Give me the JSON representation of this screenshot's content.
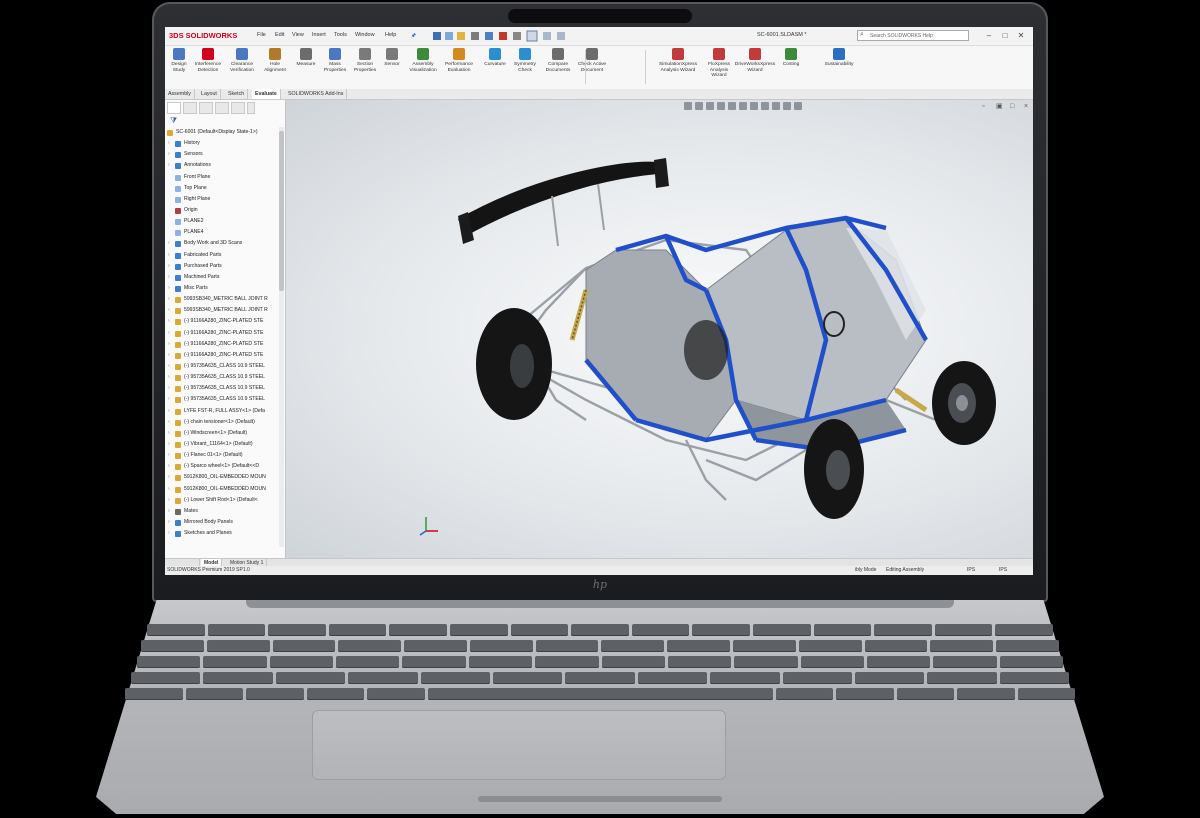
{
  "app": {
    "logo": "3DS SOLIDWORKS",
    "menus": [
      "File",
      "Edit",
      "View",
      "Insert",
      "Tools",
      "Window",
      "Help"
    ],
    "document_title": "SC-6001.SLDASM *",
    "help_search_placeholder": "Search SOLIDWORKS Help"
  },
  "ribbon": {
    "buttons": [
      {
        "label": "Design Study",
        "icon": "design-study-icon",
        "color": "#4a78c2"
      },
      {
        "label": "Interference Detection",
        "icon": "interference-icon",
        "color": "#d0021b"
      },
      {
        "label": "Clearance Verification",
        "icon": "clearance-icon",
        "color": "#4a78c2"
      },
      {
        "label": "Hole Alignment",
        "icon": "hole-alignment-icon",
        "color": "#b07a2a"
      },
      {
        "label": "Measure",
        "icon": "measure-icon",
        "color": "#6c6c6c"
      },
      {
        "label": "Mass Properties",
        "icon": "mass-properties-icon",
        "color": "#4a78c2"
      },
      {
        "label": "Section Properties",
        "icon": "section-properties-icon",
        "color": "#7a7a7a"
      },
      {
        "label": "Sensor",
        "icon": "sensor-icon",
        "color": "#7a7a7a"
      },
      {
        "label": "Assembly Visualization",
        "icon": "assembly-visualization-icon",
        "color": "#3b8b3b"
      },
      {
        "label": "Performance Evaluation",
        "icon": "performance-icon",
        "color": "#d28a1e"
      },
      {
        "label": "Curvature",
        "icon": "curvature-icon",
        "color": "#2a8fd0"
      },
      {
        "label": "Symmetry Check",
        "icon": "symmetry-icon",
        "color": "#2a8fd0"
      },
      {
        "label": "Compare Documents",
        "icon": "compare-icon",
        "color": "#6c6c6c"
      },
      {
        "label": "Check Active Document",
        "icon": "check-active-icon",
        "color": "#6c6c6c"
      },
      {
        "label": "SimulationXpress Analysis Wizard",
        "icon": "simulationxpress-icon",
        "color": "#c23b3b"
      },
      {
        "label": "FloXpress Analysis Wizard",
        "icon": "floxpress-icon",
        "color": "#c23b3b"
      },
      {
        "label": "DriveWorksXpress Wizard",
        "icon": "driveworks-icon",
        "color": "#c23b3b"
      },
      {
        "label": "Costing",
        "icon": "costing-icon",
        "color": "#3b8b3b"
      },
      {
        "label": "Sustainability",
        "icon": "sustainability-icon",
        "color": "#2a6fc2"
      }
    ]
  },
  "command_tabs": [
    "Assembly",
    "Layout",
    "Sketch",
    "Evaluate",
    "SOLIDWORKS Add-Ins"
  ],
  "active_command_tab": "Evaluate",
  "feature_tree": {
    "root": "SC-6001  (Default<Display State-1>)",
    "items": [
      {
        "label": "History",
        "icon": "folder"
      },
      {
        "label": "Sensors",
        "icon": "folder"
      },
      {
        "label": "Annotations",
        "icon": "folder"
      },
      {
        "label": "Front Plane",
        "icon": "plane"
      },
      {
        "label": "Top Plane",
        "icon": "plane"
      },
      {
        "label": "Right Plane",
        "icon": "plane"
      },
      {
        "label": "Origin",
        "icon": "origin"
      },
      {
        "label": "PLANE2",
        "icon": "plane"
      },
      {
        "label": "PLANE4",
        "icon": "plane"
      },
      {
        "label": "Body Work and 3D Scans",
        "icon": "folder"
      },
      {
        "label": "Fabricated Parts",
        "icon": "folder"
      },
      {
        "label": "Purchased Parts",
        "icon": "folder"
      },
      {
        "label": "Machined Parts",
        "icon": "folder"
      },
      {
        "label": "Misc Parts",
        "icon": "folder"
      },
      {
        "label": "5993SB340_METRIC BALL JOINT R",
        "icon": "part"
      },
      {
        "label": "5993SB340_METRIC BALL JOINT R",
        "icon": "part"
      },
      {
        "label": "(-) 91166A280_ZINC-PLATED STE",
        "icon": "part"
      },
      {
        "label": "(-) 91166A280_ZINC-PLATED STE",
        "icon": "part"
      },
      {
        "label": "(-) 91166A280_ZINC-PLATED STE",
        "icon": "part"
      },
      {
        "label": "(-) 91166A280_ZINC-PLATED STE",
        "icon": "part"
      },
      {
        "label": "(-) 95735A635_CLASS 10.9 STEEL",
        "icon": "part"
      },
      {
        "label": "(-) 95735A635_CLASS 10.9 STEEL",
        "icon": "part"
      },
      {
        "label": "(-) 95735A635_CLASS 10.9 STEEL",
        "icon": "part"
      },
      {
        "label": "(-) 95735A635_CLASS 10.9 STEEL",
        "icon": "part"
      },
      {
        "label": "LYFE FST-R, FULL ASSY<1> (Defa",
        "icon": "part"
      },
      {
        "label": "(-) chain tensioner<1> (Default)",
        "icon": "part"
      },
      {
        "label": "(-) Windscreen<1> (Default)",
        "icon": "part"
      },
      {
        "label": "(-) Vibrant_11164<1> (Default)",
        "icon": "part"
      },
      {
        "label": "(-) Flanec 01<1> (Default)",
        "icon": "part"
      },
      {
        "label": "(-) Sparco wheel<1> (Default<<D",
        "icon": "part"
      },
      {
        "label": "5912K800_OIL-EMBEDDED MOUN",
        "icon": "part"
      },
      {
        "label": "5912K800_OIL-EMBEDDED MOUN",
        "icon": "part"
      },
      {
        "label": "(-) Lower Shift Rod<1> (Default<",
        "icon": "part"
      },
      {
        "label": "Mates",
        "icon": "mates"
      },
      {
        "label": "Mirrored Body Panels",
        "icon": "folder"
      },
      {
        "label": "Sketches and Planes",
        "icon": "folder"
      }
    ]
  },
  "bottom_tabs": [
    "Model",
    "Motion Study 1"
  ],
  "active_bottom_tab": "Model",
  "status": {
    "version": "SOLIDWORKS Premium 2019 SP1.0",
    "mode_left": "ibly Mode",
    "mode": "Editing Assembly",
    "units_1": "IPS",
    "units_2": "IPS"
  },
  "hardware": {
    "brand_logo": "hp"
  },
  "colors": {
    "frame_blue": "#1f4fc9",
    "body_panel_grey": "#a7acb2",
    "tire_black": "#151515",
    "suspension_grey": "#9aa0a6"
  }
}
